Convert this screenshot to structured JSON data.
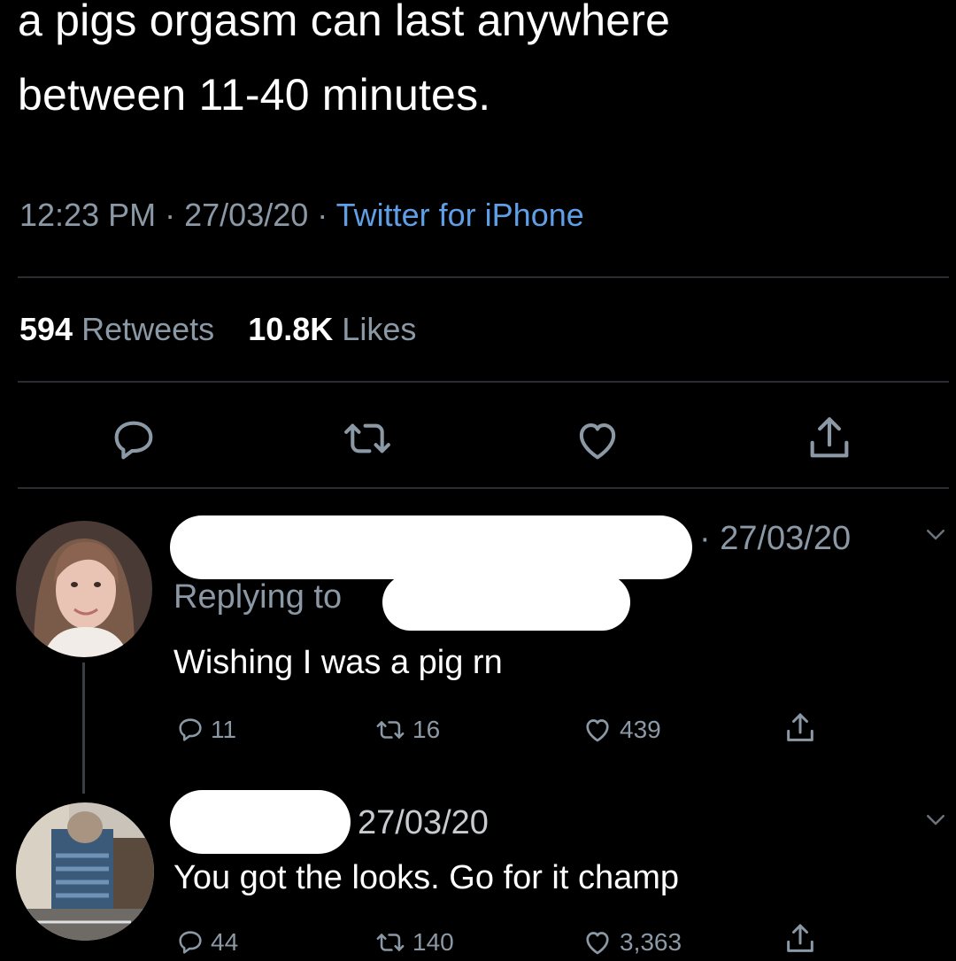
{
  "tweet": {
    "text_line1": "a pigs orgasm can last anywhere",
    "text_line2": "between 11-40 minutes.",
    "time": "12:23 PM",
    "date": "27/03/20",
    "separator": "·",
    "source": "Twitter for iPhone",
    "retweets_count": "594",
    "retweets_label": "Retweets",
    "likes_count": "10.8K",
    "likes_label": "Likes"
  },
  "actions": [
    "reply-icon",
    "retweet-icon",
    "like-icon",
    "share-icon"
  ],
  "replies": [
    {
      "date": "· 27/03/20",
      "replying_to": "Replying to",
      "text": "Wishing I was a pig rn",
      "reply_count": "11",
      "retweet_count": "16",
      "like_count": "439"
    },
    {
      "date": "27/03/20",
      "text": "You got the looks. Go for it champ",
      "reply_count": "44",
      "retweet_count": "140",
      "like_count": "3,363"
    }
  ],
  "colors": {
    "background": "#000000",
    "text": "#ffffff",
    "muted": "#8b98a5",
    "link": "#5f9fe6",
    "divider": "#2a2d31"
  }
}
